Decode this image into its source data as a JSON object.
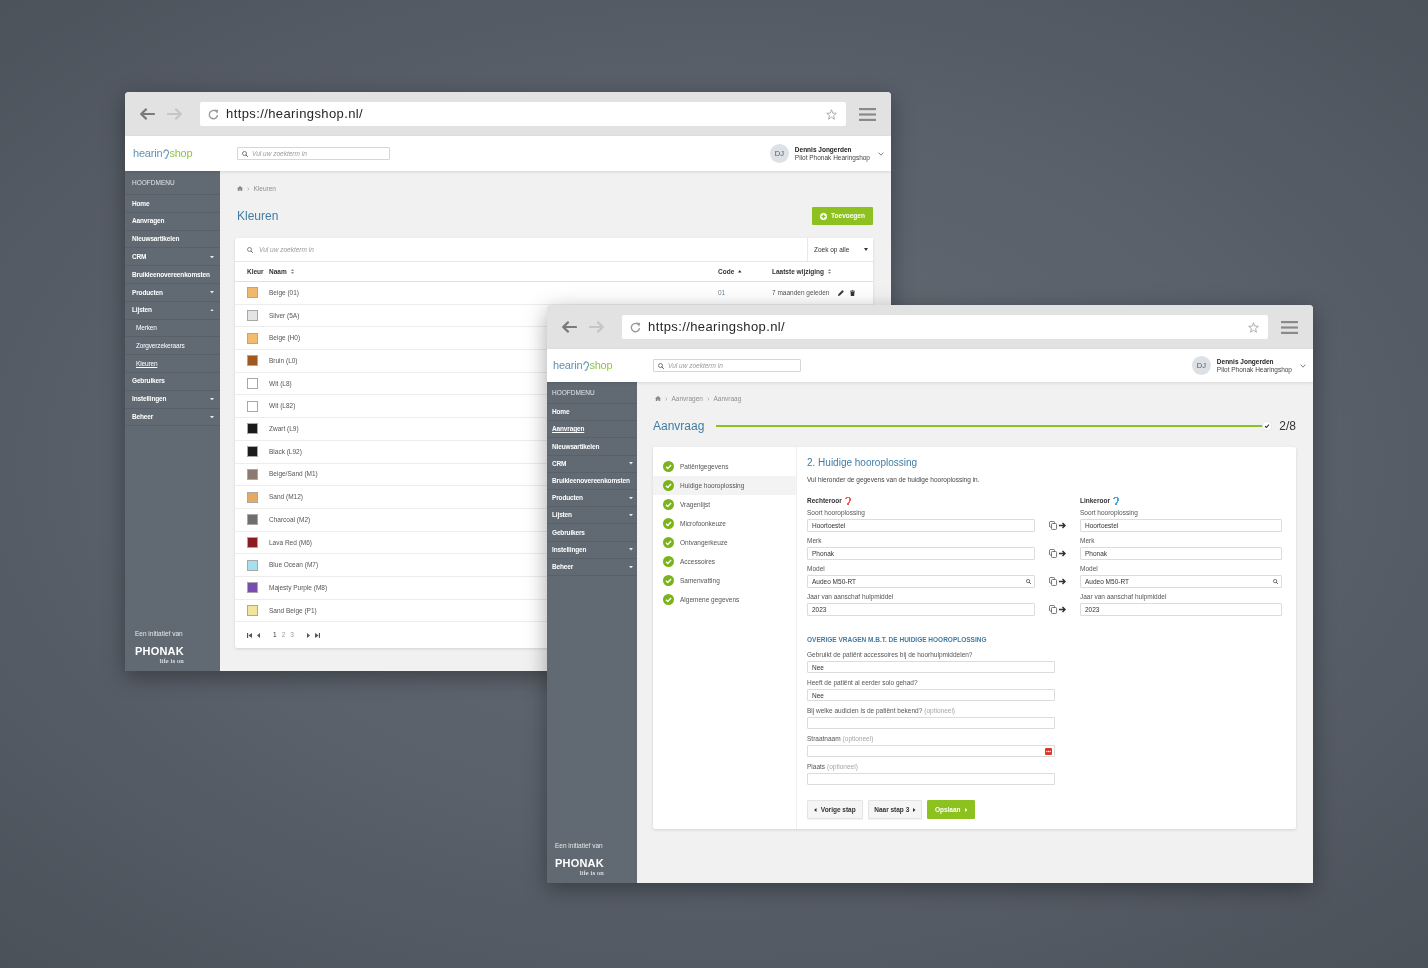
{
  "back_window": {
    "url": "https://hearingshop.nl/",
    "header": {
      "logo": {
        "part_1": "hearin",
        "part_2": "shop"
      },
      "search_placeholder": "Vul uw zoekterm in",
      "avatar_initials": "DJ",
      "user_name": "Dennis Jongerden",
      "user_role": "Pilot Phonak Hearingshop"
    },
    "sidebar": {
      "heading": "HOOFDMENU",
      "items": [
        {
          "kind": "link",
          "label": "Home",
          "selected": false
        },
        {
          "kind": "link",
          "label": "Aanvragen",
          "selected": false
        },
        {
          "kind": "link",
          "label": "Nieuwsartikelen",
          "selected": false
        },
        {
          "kind": "group",
          "label": "CRM",
          "selected": false,
          "expanded": false
        },
        {
          "kind": "link",
          "label": "Bruikleenovereenkomsten",
          "selected": false
        },
        {
          "kind": "group",
          "label": "Producten",
          "selected": false,
          "expanded": false
        },
        {
          "kind": "group",
          "label": "Lijsten",
          "selected": false,
          "expanded": true,
          "children": [
            {
              "label": "Merken",
              "selected": false
            },
            {
              "label": "Zorgverzekeraars",
              "selected": false
            },
            {
              "label": "Kleuren",
              "selected": true
            }
          ]
        },
        {
          "kind": "link",
          "label": "Gebruikers",
          "selected": false
        },
        {
          "kind": "group",
          "label": "Instellingen",
          "selected": false,
          "expanded": false
        },
        {
          "kind": "group",
          "label": "Beheer",
          "selected": false,
          "expanded": false
        }
      ],
      "footer": {
        "caption": "Een initiatief van",
        "brand": "PHONAK",
        "slogan": "life is on"
      }
    },
    "breadcrumb": [
      {
        "label": "Kleuren"
      }
    ],
    "title": "Kleuren",
    "add_button": "Toevoegen",
    "table": {
      "search_placeholder": "Vul uw zoekterm in",
      "filter": "Zoek op alle",
      "columns": [
        {
          "label": "Kleur",
          "sortable": false,
          "sorted": false
        },
        {
          "label": "Naam",
          "sortable": true,
          "sorted": false
        },
        {
          "label": "Code",
          "sortable": true,
          "sorted": true
        },
        {
          "label": "Laatste wijziging",
          "sortable": true,
          "sorted": false
        }
      ],
      "rows": [
        {
          "color": "#f0b86c",
          "name": "Beige (01)",
          "code": "01",
          "modified": "7 maanden geleden"
        },
        {
          "color": "#e4e4e4",
          "name": "Silver (5A)"
        },
        {
          "color": "#f2bb6e",
          "name": "Beige (H0)"
        },
        {
          "color": "#a0581e",
          "name": "Bruin (L0)"
        },
        {
          "color": "#ffffff",
          "name": "Wit (L8)"
        },
        {
          "color": "#ffffff",
          "name": "Wit (L82)"
        },
        {
          "color": "#1a1a1a",
          "name": "Zwart (L9)"
        },
        {
          "color": "#1c1c1c",
          "name": "Black (L92)"
        },
        {
          "color": "#8a7a70",
          "name": "Beige/Sand (M1)"
        },
        {
          "color": "#e8a860",
          "name": "Sand (M12)"
        },
        {
          "color": "#6d6e70",
          "name": "Charcoal (M2)"
        },
        {
          "color": "#8b1a22",
          "name": "Lava Red (M6)"
        },
        {
          "color": "#a6e0ef",
          "name": "Blue Ocean (M7)"
        },
        {
          "color": "#7a4cb0",
          "name": "Majesty Purple (M8)"
        },
        {
          "color": "#f2e49a",
          "name": "Sand Beige (P1)"
        }
      ],
      "pagination": [
        {
          "label": "1",
          "selected": true
        },
        {
          "label": "2",
          "selected": false
        },
        {
          "label": "3",
          "selected": false
        }
      ]
    }
  },
  "front_window": {
    "url": "https://hearingshop.nl/",
    "header": {
      "logo": {
        "part_1": "hearin",
        "part_2": "shop"
      },
      "search_placeholder": "Vul uw zoekterm in",
      "avatar_initials": "DJ",
      "user_name": "Dennis Jongerden",
      "user_role": "Pilot Phonak Hearingshop"
    },
    "sidebar": {
      "heading": "HOOFDMENU",
      "items": [
        {
          "kind": "link",
          "label": "Home",
          "selected": false
        },
        {
          "kind": "link",
          "label": "Aanvragen",
          "selected": true
        },
        {
          "kind": "link",
          "label": "Nieuwsartikelen",
          "selected": false
        },
        {
          "kind": "group",
          "label": "CRM",
          "selected": false,
          "expanded": false
        },
        {
          "kind": "link",
          "label": "Bruikleenovereenkomsten",
          "selected": false
        },
        {
          "kind": "group",
          "label": "Producten",
          "selected": false,
          "expanded": false
        },
        {
          "kind": "group",
          "label": "Lijsten",
          "selected": false,
          "expanded": false
        },
        {
          "kind": "link",
          "label": "Gebruikers",
          "selected": false
        },
        {
          "kind": "group",
          "label": "Instellingen",
          "selected": false,
          "expanded": false
        },
        {
          "kind": "group",
          "label": "Beheer",
          "selected": false,
          "expanded": false
        }
      ],
      "footer": {
        "caption": "Een initiatief van",
        "brand": "PHONAK",
        "slogan": "life is on"
      }
    },
    "breadcrumb": [
      {
        "label": "Aanvragen"
      },
      {
        "label": "Aanvraag"
      }
    ],
    "title": "Aanvraag",
    "step_counter": "2/8",
    "steps": [
      {
        "label": "Patiëntgegevens",
        "done": true,
        "selected": false
      },
      {
        "label": "Huidige hooroplossing",
        "done": true,
        "selected": true
      },
      {
        "label": "Vragenlijst",
        "done": true,
        "selected": false
      },
      {
        "label": "Microfoonkeuze",
        "done": true,
        "selected": false
      },
      {
        "label": "Ontvangerkeuze",
        "done": true,
        "selected": false
      },
      {
        "label": "Accessoires",
        "done": true,
        "selected": false
      },
      {
        "label": "Samenvatting",
        "done": true,
        "selected": false
      },
      {
        "label": "Algemene gegevens",
        "done": true,
        "selected": false
      }
    ],
    "form": {
      "title": "2. Huidige hooroplossing",
      "intro": "Vul hieronder de gegevens van de huidige hooroplossing in.",
      "ears": [
        {
          "label": "Rechteroor",
          "color": "#e8605a",
          "fields": [
            {
              "kind": "select",
              "label": "Soort hooroplossing",
              "value": "Hoortoestel"
            },
            {
              "kind": "select",
              "label": "Merk",
              "value": "Phonak"
            },
            {
              "kind": "search",
              "label": "Model",
              "value": "Audeo M50-RT"
            },
            {
              "kind": "text",
              "label": "Jaar van aanschaf hulpmiddel",
              "value": "2023"
            }
          ]
        },
        {
          "label": "Linkeroor",
          "color": "#4aa3df",
          "fields": [
            {
              "kind": "select",
              "label": "Soort hooroplossing",
              "value": "Hoortoestel"
            },
            {
              "kind": "select",
              "label": "Merk",
              "value": "Phonak"
            },
            {
              "kind": "search",
              "label": "Model",
              "value": "Audeo M50-RT"
            },
            {
              "kind": "text",
              "label": "Jaar van aanschaf hulpmiddel",
              "value": "2023"
            }
          ]
        }
      ],
      "section_heading": "OVERIGE VRAGEN M.B.T. DE HUIDIGE HOOROPLOSSING",
      "questions": [
        {
          "kind": "select",
          "label": "Gebruikt de patiënt accessoires bij de hoorhulpmiddelen?",
          "value": "Nee"
        },
        {
          "kind": "select",
          "label": "Heeft de patiënt al eerder solo gehad?",
          "value": "Nee"
        },
        {
          "kind": "text",
          "label": "Bij welke audicien is de patiënt bekend?",
          "hint": "(optioneel)"
        },
        {
          "kind": "autofill",
          "label": "Straatnaam",
          "hint": "(optioneel)"
        },
        {
          "kind": "text",
          "label": "Plaats",
          "hint": "(optioneel)"
        }
      ],
      "buttons": [
        {
          "kind": "previous",
          "label": "Vorige stap"
        },
        {
          "kind": "next",
          "label": "Naar stap 3"
        },
        {
          "kind": "primary",
          "label": "Opslaan"
        }
      ]
    }
  }
}
